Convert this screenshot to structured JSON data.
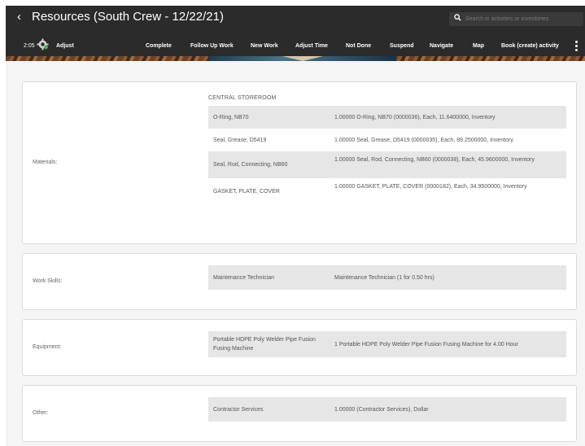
{
  "header": {
    "back_icon": "chevron-left-icon",
    "title": "Resources (South Crew - 12/22/21)",
    "search": {
      "placeholder": "Search in activities or inventories",
      "icon": "search-icon"
    },
    "time": "2:05",
    "adjust_label": "Adjust",
    "actions": [
      "Complete",
      "Follow Up Work",
      "New Work",
      "Adjust Time",
      "Not Done",
      "Suspend",
      "Navigate",
      "Map",
      "Book (create) activity"
    ],
    "more_icon": "kebab-menu-icon",
    "colors": {
      "bar": "#2b2b2b",
      "text": "#ffffff"
    }
  },
  "sections": {
    "materials": {
      "label": "Materials:",
      "storeroom": "CENTRAL STOREROOM",
      "rows": [
        {
          "name": "O-Ring, NB70",
          "desc": "1.00000 O-Ring, NB70 (0000036), Each, 11.6400000, Inventory"
        },
        {
          "name": "Seal, Grease, D5419",
          "desc": "1.00000 Seal, Grease, D5419 (0000035), Each, 89.2500000, Inventory"
        },
        {
          "name": "Seal, Rod, Connecting, NB60",
          "desc": "1.00000 Seal, Rod, Connecting, NB60 (0000038), Each, 45.9600000, Inventory"
        },
        {
          "name": "GASKET, PLATE, COVER",
          "desc": "1.00000 GASKET, PLATE, COVER (0000182), Each, 34.9500000, Inventory"
        }
      ]
    },
    "work_skills": {
      "label": "Work Skills:",
      "rows": [
        {
          "name": "Maintenance Technician",
          "desc": "Maintenance Technician (1 for 0.50 hrs)"
        }
      ]
    },
    "equipment": {
      "label": "Equipment:",
      "rows": [
        {
          "name": "Portable HDPE Poly Welder Pipe Fusion Fusing Machine",
          "desc": "1 Portable HDPE Poly Welder Pipe Fusion Fusing Machine for 4.00 Hour"
        }
      ]
    },
    "other": {
      "label": "Other:",
      "rows": [
        {
          "name": "Contractor Services",
          "desc": "1.00000 (Contractor Services), Dollar"
        }
      ]
    }
  }
}
